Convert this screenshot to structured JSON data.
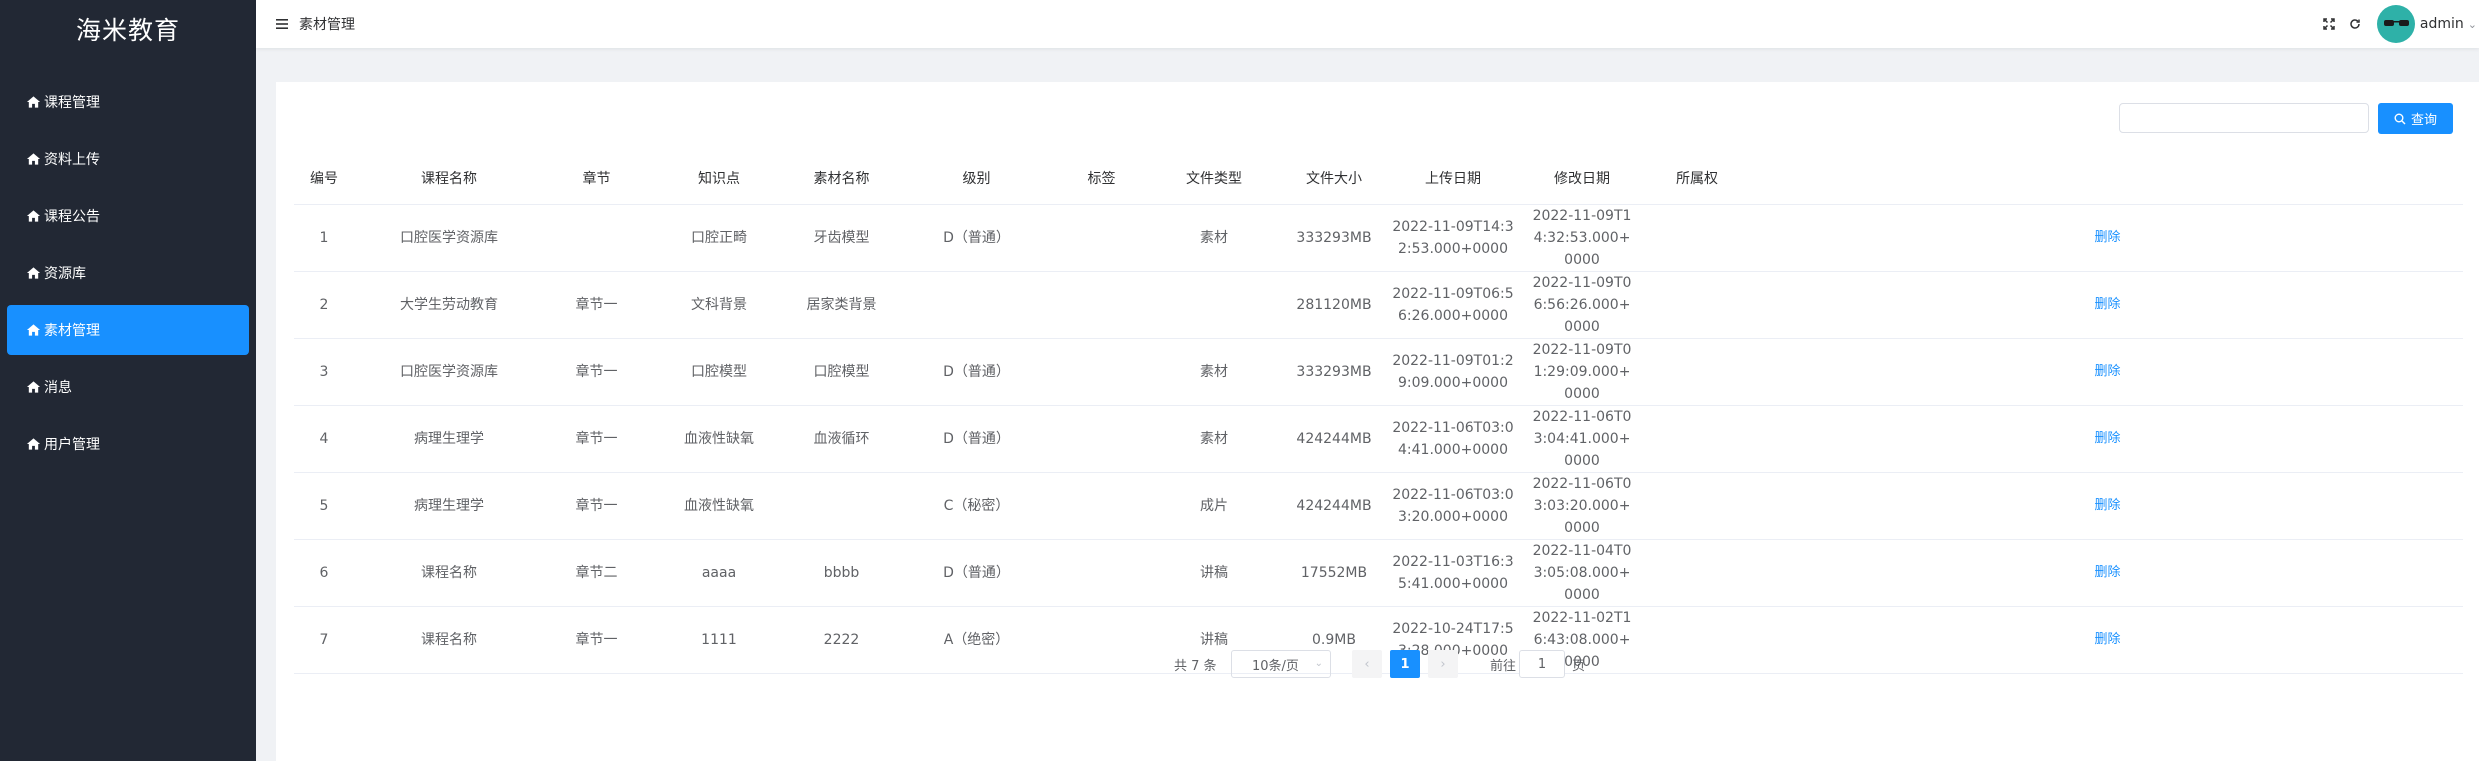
{
  "app": {
    "title": "海米教育"
  },
  "sidebar": {
    "items": [
      {
        "label": "课程管理",
        "icon": "home-icon"
      },
      {
        "label": "资料上传",
        "icon": "home-icon"
      },
      {
        "label": "课程公告",
        "icon": "home-icon"
      },
      {
        "label": "资源库",
        "icon": "home-icon"
      },
      {
        "label": "素材管理",
        "icon": "home-icon",
        "active": true
      },
      {
        "label": "消息",
        "icon": "home-icon"
      },
      {
        "label": "用户管理",
        "icon": "home-icon"
      }
    ]
  },
  "header": {
    "breadcrumb": "素材管理",
    "user": "admin",
    "icons": [
      "menu-icon",
      "fullscreen-icon",
      "refresh-icon",
      "chevron-down-icon"
    ]
  },
  "search": {
    "value": "",
    "placeholder": "",
    "button_label": "查询"
  },
  "table": {
    "columns": [
      "编号",
      "课程名称",
      "章节",
      "知识点",
      "素材名称",
      "级别",
      "标签",
      "文件类型",
      "文件大小",
      "上传日期",
      "修改日期",
      "所属权",
      ""
    ],
    "rows": [
      {
        "id": "1",
        "course": "口腔医学资源库",
        "chapter": "",
        "point": "口腔正畸",
        "material": "牙齿模型",
        "level": "D（普通）",
        "tag": "",
        "type": "素材",
        "size": "333293MB",
        "uploaded": "2022-11-09T14:32:53.000+0000",
        "modified": "2022-11-09T14:32:53.000+0000",
        "owner": "",
        "action": "删除"
      },
      {
        "id": "2",
        "course": "大学生劳动教育",
        "chapter": "章节一",
        "point": "文科背景",
        "material": "居家类背景",
        "level": "",
        "tag": "",
        "type": "",
        "size": "281120MB",
        "uploaded": "2022-11-09T06:56:26.000+0000",
        "modified": "2022-11-09T06:56:26.000+0000",
        "owner": "",
        "action": "删除"
      },
      {
        "id": "3",
        "course": "口腔医学资源库",
        "chapter": "章节一",
        "point": "口腔模型",
        "material": "口腔模型",
        "level": "D（普通）",
        "tag": "",
        "type": "素材",
        "size": "333293MB",
        "uploaded": "2022-11-09T01:29:09.000+0000",
        "modified": "2022-11-09T01:29:09.000+0000",
        "owner": "",
        "action": "删除"
      },
      {
        "id": "4",
        "course": "病理生理学",
        "chapter": "章节一",
        "point": "血液性缺氧",
        "material": "血液循环",
        "level": "D（普通）",
        "tag": "",
        "type": "素材",
        "size": "424244MB",
        "uploaded": "2022-11-06T03:04:41.000+0000",
        "modified": "2022-11-06T03:04:41.000+0000",
        "owner": "",
        "action": "删除"
      },
      {
        "id": "5",
        "course": "病理生理学",
        "chapter": "章节一",
        "point": "血液性缺氧",
        "material": "",
        "level": "C（秘密）",
        "tag": "",
        "type": "成片",
        "size": "424244MB",
        "uploaded": "2022-11-06T03:03:20.000+0000",
        "modified": "2022-11-06T03:03:20.000+0000",
        "owner": "",
        "action": "删除"
      },
      {
        "id": "6",
        "course": "课程名称",
        "chapter": "章节二",
        "point": "aaaa",
        "material": "bbbb",
        "level": "D（普通）",
        "tag": "",
        "type": "讲稿",
        "size": "17552MB",
        "uploaded": "2022-11-03T16:35:41.000+0000",
        "modified": "2022-11-04T03:05:08.000+0000",
        "owner": "",
        "action": "删除"
      },
      {
        "id": "7",
        "course": "课程名称",
        "chapter": "章节一",
        "point": "1111",
        "material": "2222",
        "level": "A（绝密）",
        "tag": "",
        "type": "讲稿",
        "size": "0.9MB",
        "uploaded": "2022-10-24T17:53:28.000+0000",
        "modified": "2022-11-02T16:43:08.000+0000",
        "owner": "",
        "action": "删除"
      }
    ]
  },
  "pagination": {
    "total": "共 7 条",
    "page_size": "10条/页",
    "current": "1",
    "goto_label": "前往",
    "goto_value": "1",
    "page_suffix": "页"
  },
  "colors": {
    "sidebar_bg": "#222834",
    "accent": "#1890ff",
    "avatar_bg": "#2eb1a8"
  }
}
